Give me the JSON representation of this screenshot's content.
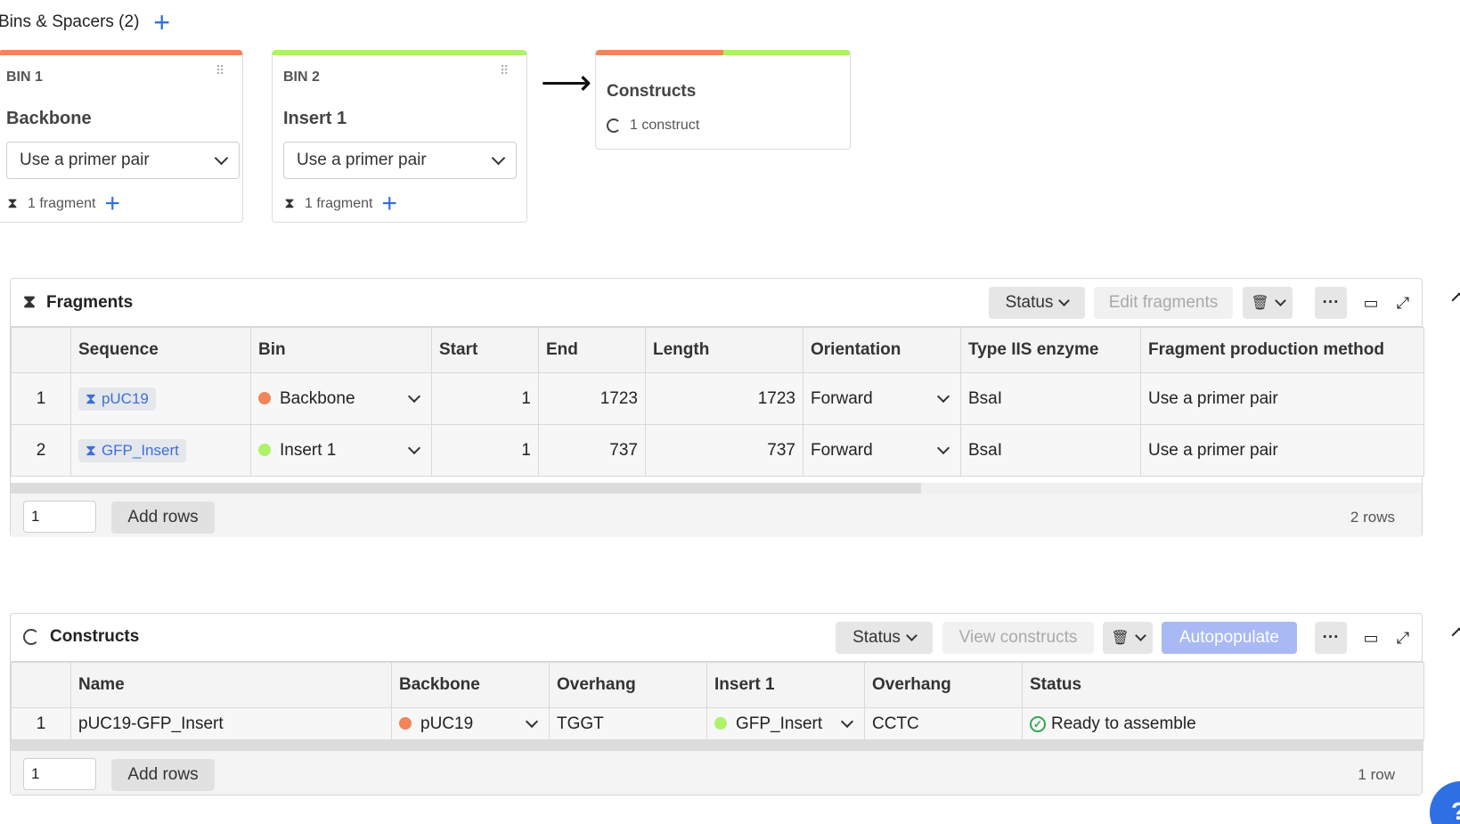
{
  "bins_header": {
    "title": "Bins & Spacers (2)"
  },
  "bins": [
    {
      "label": "BIN 1",
      "name": "Backbone",
      "method": "Use a primer pair",
      "fragments": "1 fragment",
      "color": "#f0855a"
    },
    {
      "label": "BIN 2",
      "name": "Insert 1",
      "method": "Use a primer pair",
      "fragments": "1 fragment",
      "color": "#aef26a"
    }
  ],
  "constructs_card": {
    "title": "Constructs",
    "count": "1 construct"
  },
  "fragments": {
    "title": "Fragments",
    "status_button": "Status",
    "edit_button": "Edit fragments",
    "columns": [
      "Sequence",
      "Bin",
      "Start",
      "End",
      "Length",
      "Orientation",
      "Type IIS enzyme",
      "Fragment production method"
    ],
    "rows": [
      {
        "index": "1",
        "sequence": "pUC19",
        "bin": "Backbone",
        "bin_color": "#f0855a",
        "start": "1",
        "end": "1723",
        "length": "1723",
        "orientation": "Forward",
        "enzyme": "BsaI",
        "method": "Use a primer pair"
      },
      {
        "index": "2",
        "sequence": "GFP_Insert",
        "bin": "Insert 1",
        "bin_color": "#aef26a",
        "start": "1",
        "end": "737",
        "length": "737",
        "orientation": "Forward",
        "enzyme": "BsaI",
        "method": "Use a primer pair"
      }
    ],
    "add_qty": "1",
    "add_button": "Add rows",
    "row_count": "2 rows"
  },
  "constructs": {
    "title": "Constructs",
    "status_button": "Status",
    "view_button": "View constructs",
    "autopopulate_button": "Autopopulate",
    "columns": [
      "Name",
      "Backbone",
      "Overhang",
      "Insert 1",
      "Overhang",
      "Status"
    ],
    "rows": [
      {
        "index": "1",
        "name": "pUC19-GFP_Insert",
        "backbone": "pUC19",
        "backbone_color": "#f0855a",
        "overhang1": "TGGT",
        "insert": "GFP_Insert",
        "insert_color": "#aef26a",
        "overhang2": "CCTC",
        "status": "Ready to assemble"
      }
    ],
    "add_qty": "1",
    "add_button": "Add rows",
    "row_count": "1 row"
  },
  "help": {
    "label": "?"
  }
}
